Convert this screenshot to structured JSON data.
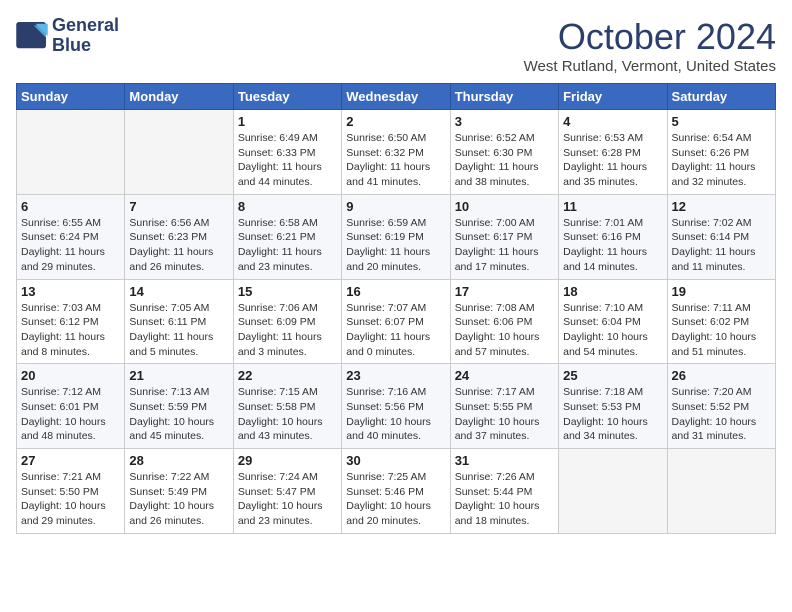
{
  "header": {
    "logo_line1": "General",
    "logo_line2": "Blue",
    "month_title": "October 2024",
    "location": "West Rutland, Vermont, United States"
  },
  "days_of_week": [
    "Sunday",
    "Monday",
    "Tuesday",
    "Wednesday",
    "Thursday",
    "Friday",
    "Saturday"
  ],
  "weeks": [
    [
      {
        "day": "",
        "detail": ""
      },
      {
        "day": "",
        "detail": ""
      },
      {
        "day": "1",
        "detail": "Sunrise: 6:49 AM\nSunset: 6:33 PM\nDaylight: 11 hours and 44 minutes."
      },
      {
        "day": "2",
        "detail": "Sunrise: 6:50 AM\nSunset: 6:32 PM\nDaylight: 11 hours and 41 minutes."
      },
      {
        "day": "3",
        "detail": "Sunrise: 6:52 AM\nSunset: 6:30 PM\nDaylight: 11 hours and 38 minutes."
      },
      {
        "day": "4",
        "detail": "Sunrise: 6:53 AM\nSunset: 6:28 PM\nDaylight: 11 hours and 35 minutes."
      },
      {
        "day": "5",
        "detail": "Sunrise: 6:54 AM\nSunset: 6:26 PM\nDaylight: 11 hours and 32 minutes."
      }
    ],
    [
      {
        "day": "6",
        "detail": "Sunrise: 6:55 AM\nSunset: 6:24 PM\nDaylight: 11 hours and 29 minutes."
      },
      {
        "day": "7",
        "detail": "Sunrise: 6:56 AM\nSunset: 6:23 PM\nDaylight: 11 hours and 26 minutes."
      },
      {
        "day": "8",
        "detail": "Sunrise: 6:58 AM\nSunset: 6:21 PM\nDaylight: 11 hours and 23 minutes."
      },
      {
        "day": "9",
        "detail": "Sunrise: 6:59 AM\nSunset: 6:19 PM\nDaylight: 11 hours and 20 minutes."
      },
      {
        "day": "10",
        "detail": "Sunrise: 7:00 AM\nSunset: 6:17 PM\nDaylight: 11 hours and 17 minutes."
      },
      {
        "day": "11",
        "detail": "Sunrise: 7:01 AM\nSunset: 6:16 PM\nDaylight: 11 hours and 14 minutes."
      },
      {
        "day": "12",
        "detail": "Sunrise: 7:02 AM\nSunset: 6:14 PM\nDaylight: 11 hours and 11 minutes."
      }
    ],
    [
      {
        "day": "13",
        "detail": "Sunrise: 7:03 AM\nSunset: 6:12 PM\nDaylight: 11 hours and 8 minutes."
      },
      {
        "day": "14",
        "detail": "Sunrise: 7:05 AM\nSunset: 6:11 PM\nDaylight: 11 hours and 5 minutes."
      },
      {
        "day": "15",
        "detail": "Sunrise: 7:06 AM\nSunset: 6:09 PM\nDaylight: 11 hours and 3 minutes."
      },
      {
        "day": "16",
        "detail": "Sunrise: 7:07 AM\nSunset: 6:07 PM\nDaylight: 11 hours and 0 minutes."
      },
      {
        "day": "17",
        "detail": "Sunrise: 7:08 AM\nSunset: 6:06 PM\nDaylight: 10 hours and 57 minutes."
      },
      {
        "day": "18",
        "detail": "Sunrise: 7:10 AM\nSunset: 6:04 PM\nDaylight: 10 hours and 54 minutes."
      },
      {
        "day": "19",
        "detail": "Sunrise: 7:11 AM\nSunset: 6:02 PM\nDaylight: 10 hours and 51 minutes."
      }
    ],
    [
      {
        "day": "20",
        "detail": "Sunrise: 7:12 AM\nSunset: 6:01 PM\nDaylight: 10 hours and 48 minutes."
      },
      {
        "day": "21",
        "detail": "Sunrise: 7:13 AM\nSunset: 5:59 PM\nDaylight: 10 hours and 45 minutes."
      },
      {
        "day": "22",
        "detail": "Sunrise: 7:15 AM\nSunset: 5:58 PM\nDaylight: 10 hours and 43 minutes."
      },
      {
        "day": "23",
        "detail": "Sunrise: 7:16 AM\nSunset: 5:56 PM\nDaylight: 10 hours and 40 minutes."
      },
      {
        "day": "24",
        "detail": "Sunrise: 7:17 AM\nSunset: 5:55 PM\nDaylight: 10 hours and 37 minutes."
      },
      {
        "day": "25",
        "detail": "Sunrise: 7:18 AM\nSunset: 5:53 PM\nDaylight: 10 hours and 34 minutes."
      },
      {
        "day": "26",
        "detail": "Sunrise: 7:20 AM\nSunset: 5:52 PM\nDaylight: 10 hours and 31 minutes."
      }
    ],
    [
      {
        "day": "27",
        "detail": "Sunrise: 7:21 AM\nSunset: 5:50 PM\nDaylight: 10 hours and 29 minutes."
      },
      {
        "day": "28",
        "detail": "Sunrise: 7:22 AM\nSunset: 5:49 PM\nDaylight: 10 hours and 26 minutes."
      },
      {
        "day": "29",
        "detail": "Sunrise: 7:24 AM\nSunset: 5:47 PM\nDaylight: 10 hours and 23 minutes."
      },
      {
        "day": "30",
        "detail": "Sunrise: 7:25 AM\nSunset: 5:46 PM\nDaylight: 10 hours and 20 minutes."
      },
      {
        "day": "31",
        "detail": "Sunrise: 7:26 AM\nSunset: 5:44 PM\nDaylight: 10 hours and 18 minutes."
      },
      {
        "day": "",
        "detail": ""
      },
      {
        "day": "",
        "detail": ""
      }
    ]
  ]
}
